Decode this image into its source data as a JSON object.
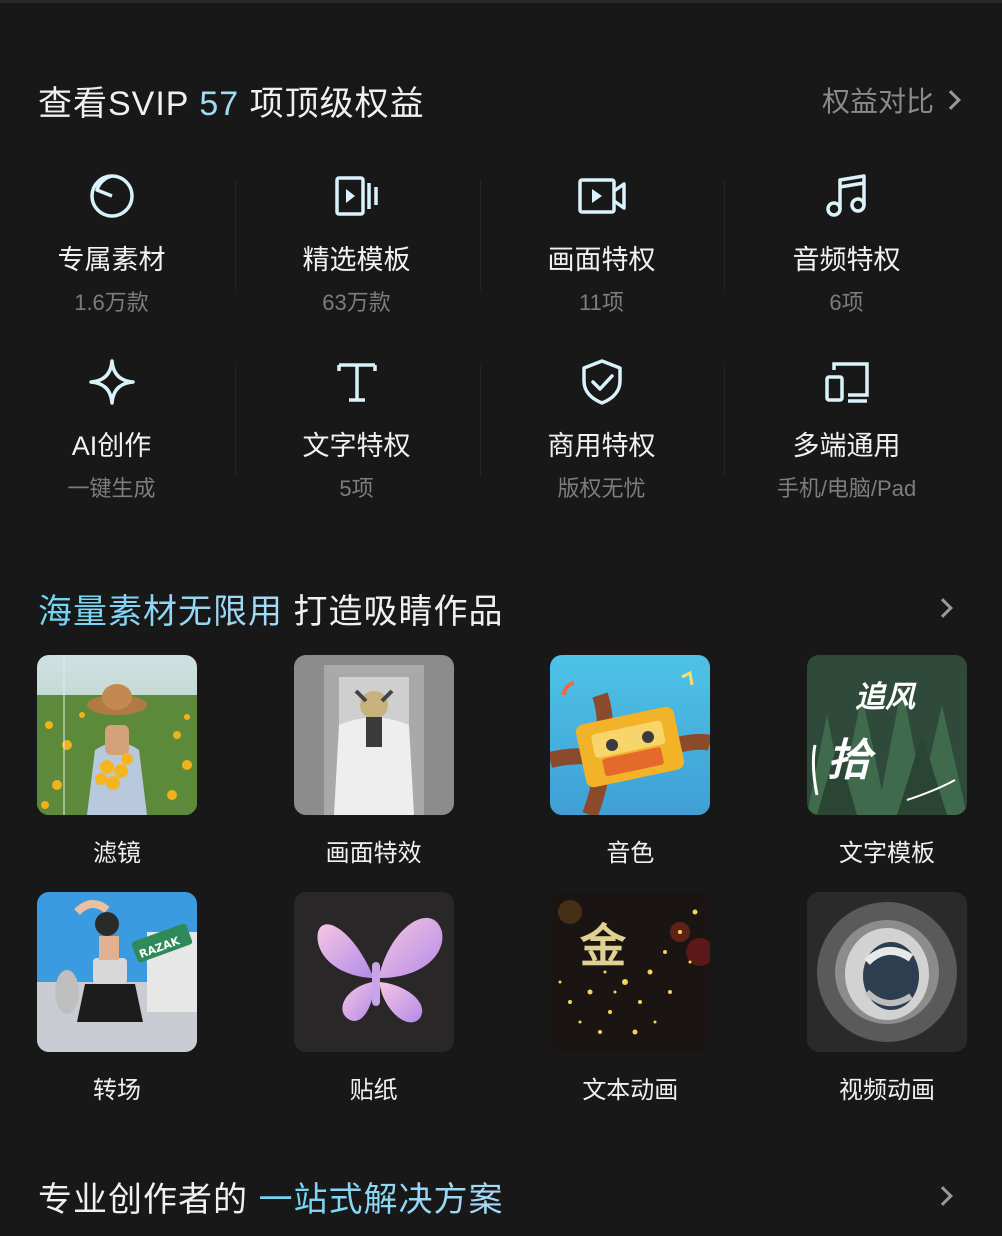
{
  "benefits_header": {
    "title_pre": "查看SVIP",
    "count": "57",
    "title_post": "项顶级权益",
    "link_label": "权益对比"
  },
  "benefits": [
    {
      "icon": "clock-circle-icon",
      "title": "专属素材",
      "sub": "1.6万款"
    },
    {
      "icon": "template-video-icon",
      "title": "精选模板",
      "sub": "63万款"
    },
    {
      "icon": "video-camera-icon",
      "title": "画面特权",
      "sub": "11项"
    },
    {
      "icon": "music-note-icon",
      "title": "音频特权",
      "sub": "6项"
    },
    {
      "icon": "sparkle-icon",
      "title": "AI创作",
      "sub": "一键生成"
    },
    {
      "icon": "text-t-icon",
      "title": "文字特权",
      "sub": "5项"
    },
    {
      "icon": "shield-check-icon",
      "title": "商用特权",
      "sub": "版权无忧"
    },
    {
      "icon": "multi-device-icon",
      "title": "多端通用",
      "sub": "手机/电脑/Pad"
    }
  ],
  "materials_header": {
    "title_accent": "海量素材无限用",
    "title_rest": " 打造吸睛作品"
  },
  "features": [
    {
      "label": "滤镜",
      "thumb": "filter-thumbnail"
    },
    {
      "label": "画面特效",
      "thumb": "effects-thumbnail"
    },
    {
      "label": "音色",
      "thumb": "voice-thumbnail"
    },
    {
      "label": "文字模板",
      "thumb": "text-template-thumbnail"
    },
    {
      "label": "转场",
      "thumb": "transition-thumbnail"
    },
    {
      "label": "贴纸",
      "thumb": "sticker-thumbnail"
    },
    {
      "label": "文本动画",
      "thumb": "text-animation-thumbnail"
    },
    {
      "label": "视频动画",
      "thumb": "video-animation-thumbnail"
    }
  ],
  "thumb_text": {
    "text_template": "追风",
    "sticker_glyph": "拾",
    "road_sign": "RAZAK",
    "text_anim_glyph": "金"
  },
  "solutions_header": {
    "title_pre": "专业创作者的 ",
    "title_accent": "一站式解决方案"
  },
  "colors": {
    "background": "#181818",
    "accent": "#9fdcf0",
    "muted": "#7d7d7d"
  }
}
